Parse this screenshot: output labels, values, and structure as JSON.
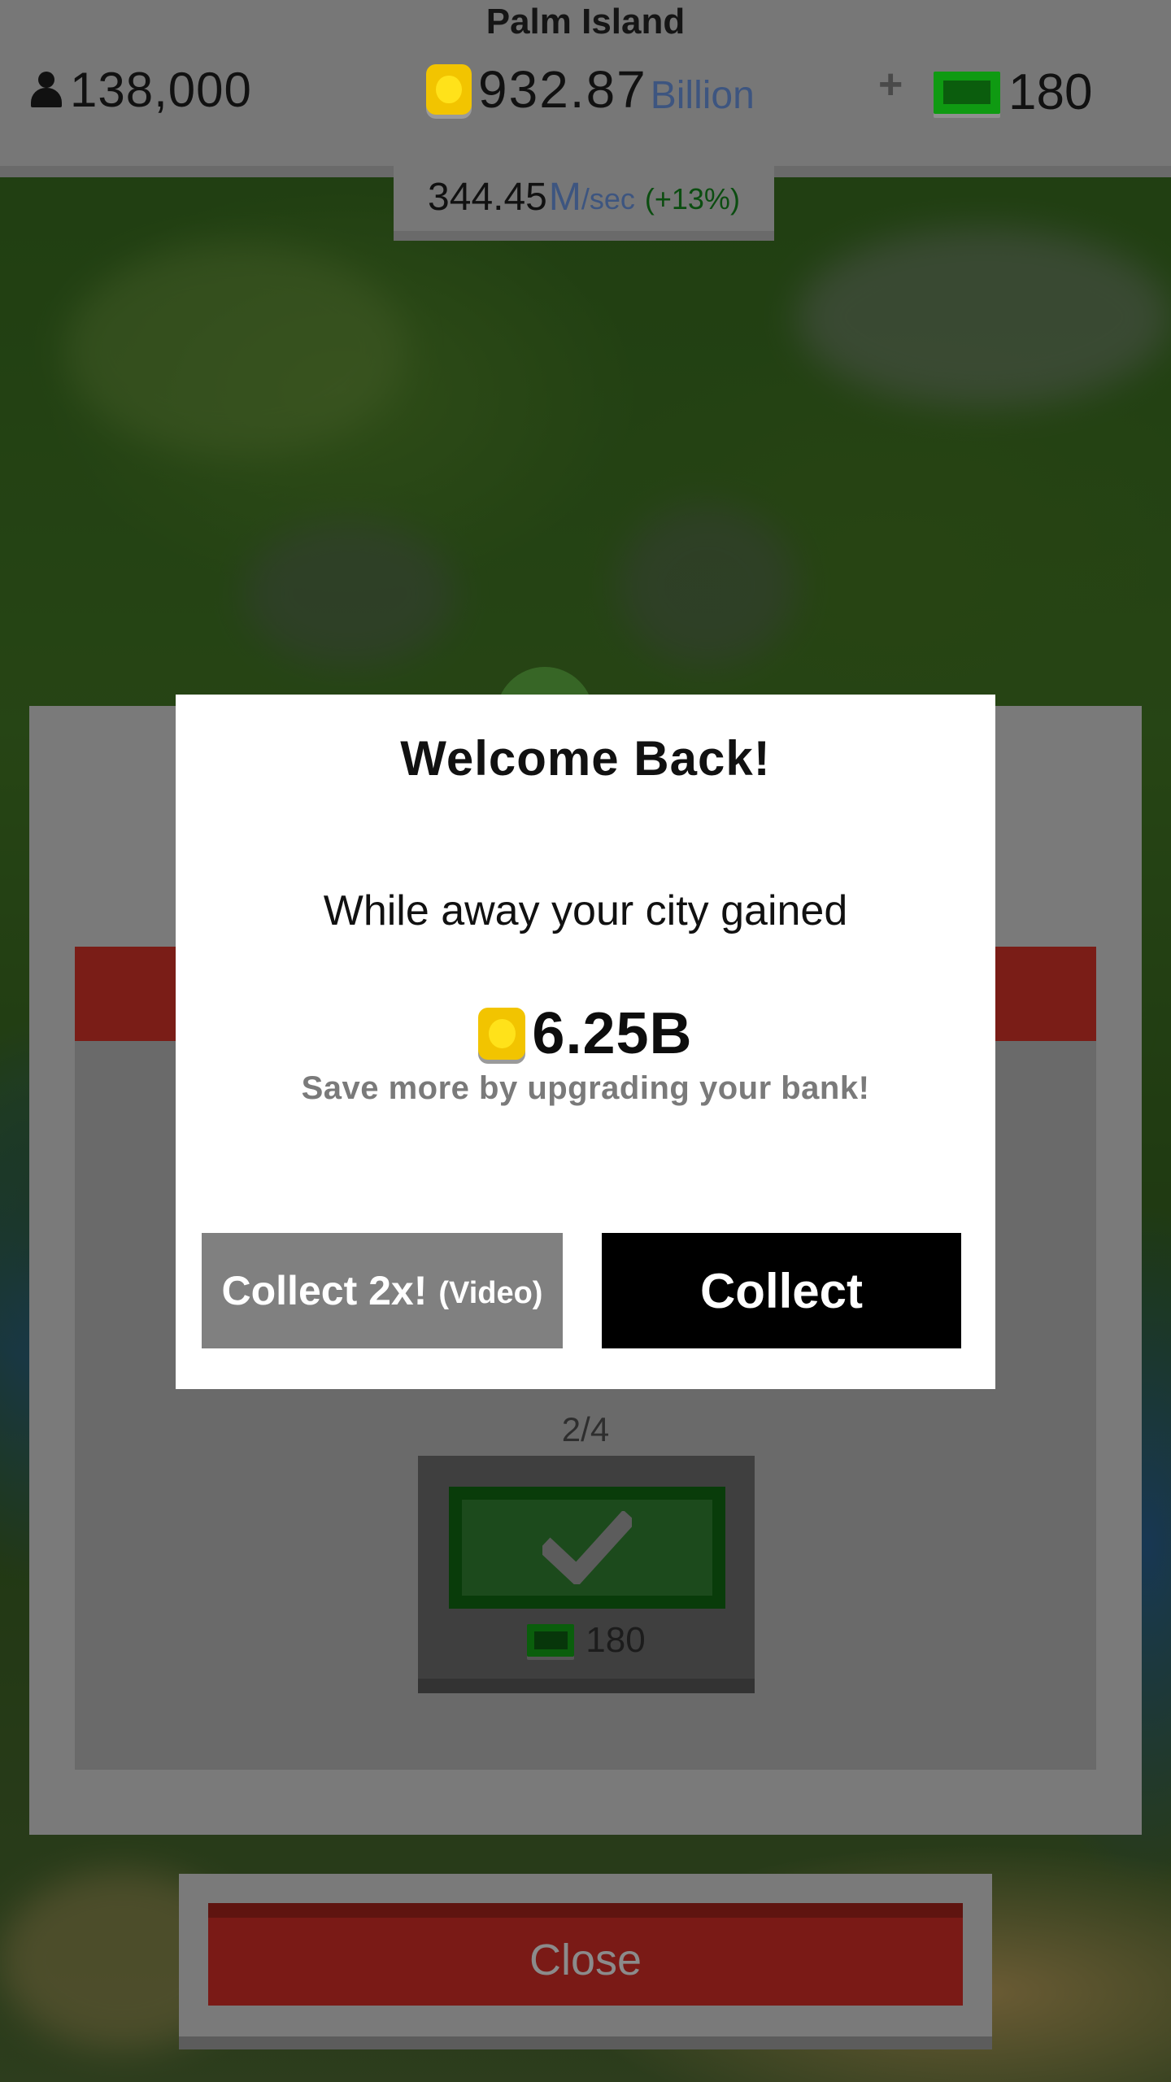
{
  "header": {
    "city_name": "Palm Island",
    "population": "138,000",
    "money_value": "932.87",
    "money_unit": "Billion",
    "add_symbol": "+",
    "cash": "180",
    "rate_value": "344.45",
    "rate_unit": "M",
    "rate_per": "/sec",
    "rate_bonus": "(+13%)"
  },
  "modal": {
    "title": "Welcome Back!",
    "message": "While away your city gained",
    "gained_amount": "6.25B",
    "hint": "Save more by upgrading your bank!",
    "video_button_label": "Collect 2x!",
    "video_button_suffix": "(Video)",
    "collect_button_label": "Collect"
  },
  "background_panel": {
    "page_indicator": "2/4",
    "reward_amount": "180",
    "close_label": "Close"
  },
  "colors": {
    "coin": "#f2c400",
    "cash_green": "#0f9a12",
    "banner_red": "#7a1d17",
    "modal_bg": "#ffffff",
    "collect_bg": "#000000",
    "video_bg": "#808080"
  },
  "icons": {
    "population": "person-icon",
    "money": "coin-icon",
    "cash": "cash-icon",
    "reward_state": "checkmark-icon"
  }
}
